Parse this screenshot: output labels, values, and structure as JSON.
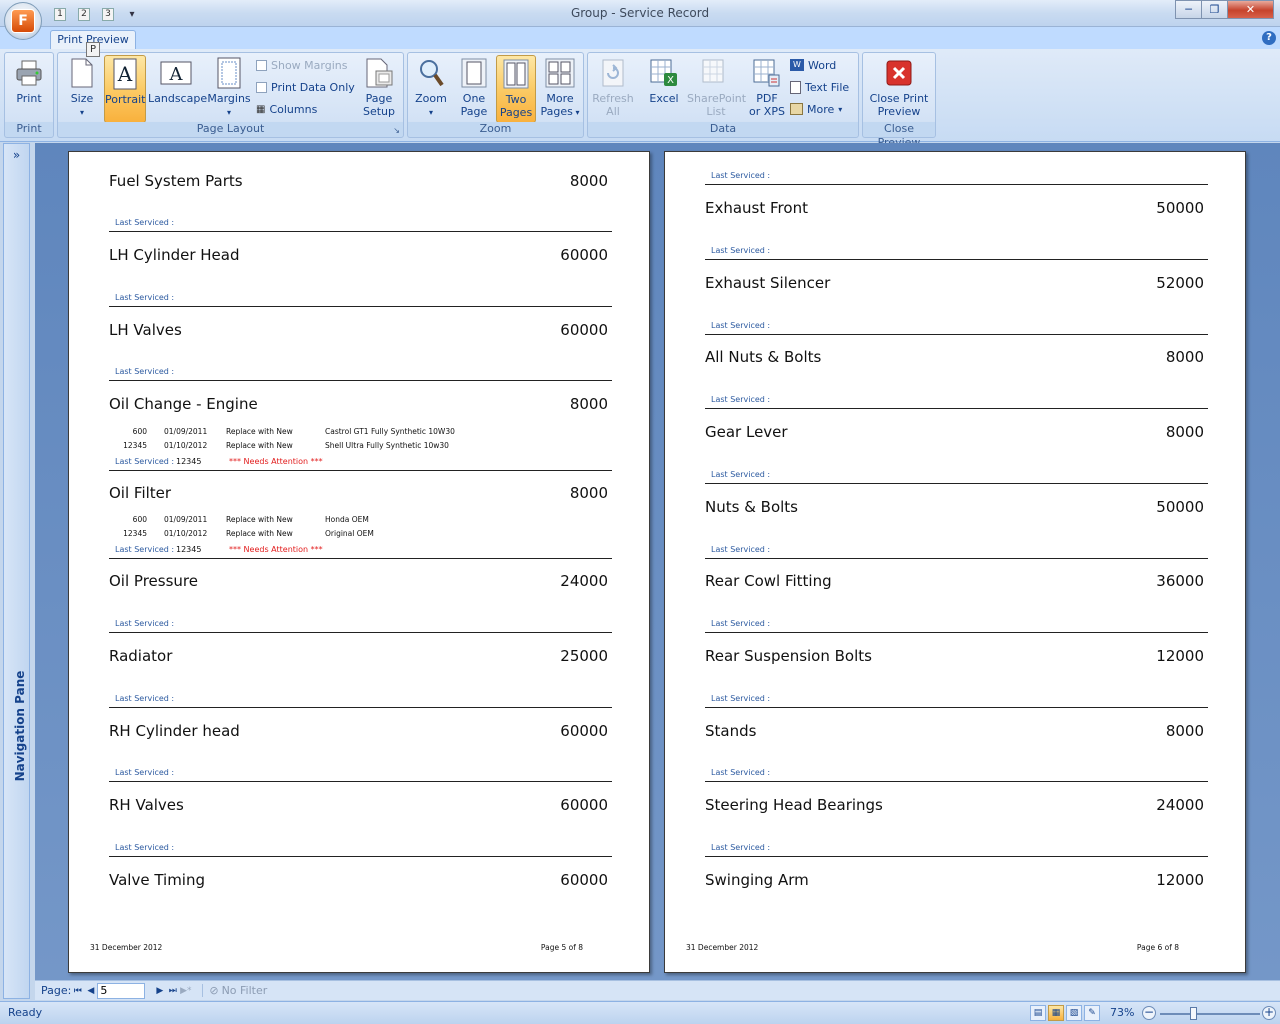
{
  "window": {
    "title": "Group  -  Service Record",
    "office_logo": "F",
    "qat_keys": [
      "1",
      "2",
      "3"
    ],
    "min": "─",
    "max": "❐",
    "close": "✕"
  },
  "ribbon": {
    "active_tab": "Print Preview",
    "keytip": "P",
    "help": "?",
    "groups": {
      "print": {
        "label": "Print",
        "print_btn": "Print"
      },
      "page_layout": {
        "label": "Page Layout",
        "size": "Size",
        "portrait": "Portrait",
        "landscape": "Landscape",
        "margins": "Margins",
        "show_margins": "Show Margins",
        "print_data_only": "Print Data Only",
        "columns": "Columns",
        "page_setup_line1": "Page",
        "page_setup_line2": "Setup"
      },
      "zoom": {
        "label": "Zoom",
        "zoom": "Zoom",
        "one_page_line1": "One",
        "one_page_line2": "Page",
        "two_pages_line1": "Two",
        "two_pages_line2": "Pages",
        "more_pages_line1": "More",
        "more_pages_line2": "Pages"
      },
      "data": {
        "label": "Data",
        "refresh_line1": "Refresh",
        "refresh_line2": "All",
        "excel": "Excel",
        "sharepoint_line1": "SharePoint",
        "sharepoint_line2": "List",
        "pdf_line1": "PDF",
        "pdf_line2": "or XPS",
        "word": "Word",
        "text_file": "Text File",
        "more": "More"
      },
      "close_preview": {
        "label": "Close Preview",
        "close_line1": "Close Print",
        "close_line2": "Preview"
      }
    }
  },
  "nav_pane": {
    "label": "Navigation Pane",
    "toggle": "»"
  },
  "report": {
    "last_serviced_label": "Last Serviced :",
    "needs_attention": "*** Needs Attention ***",
    "left_page": {
      "records": [
        {
          "item": "Fuel System Parts",
          "miles": "8000"
        },
        {
          "item": "LH Cylinder Head",
          "miles": "60000"
        },
        {
          "item": "LH Valves",
          "miles": "60000"
        },
        {
          "item": "Oil Change - Engine",
          "miles": "8000"
        },
        {
          "item": "Oil Filter",
          "miles": "8000"
        },
        {
          "item": "Oil Pressure",
          "miles": "24000"
        },
        {
          "item": "Radiator",
          "miles": "25000"
        },
        {
          "item": "RH Cylinder head",
          "miles": "60000"
        },
        {
          "item": "RH Valves",
          "miles": "60000"
        },
        {
          "item": "Valve Timing",
          "miles": "60000"
        }
      ],
      "oil_change_services": [
        {
          "miles": "600",
          "date": "01/09/2011",
          "action": "Replace with New",
          "part": "Castrol GT1 Fully Synthetic 10W30"
        },
        {
          "miles": "12345",
          "date": "01/10/2012",
          "action": "Replace with New",
          "part": "Shell Ultra Fully Synthetic 10w30"
        }
      ],
      "oil_change_last": "12345",
      "oil_filter_services": [
        {
          "miles": "600",
          "date": "01/09/2011",
          "action": "Replace with New",
          "part": "Honda OEM"
        },
        {
          "miles": "12345",
          "date": "01/10/2012",
          "action": "Replace with New",
          "part": "Original OEM"
        }
      ],
      "oil_filter_last": "12345",
      "footer_date": "31 December 2012",
      "footer_page": "Page 5 of 8"
    },
    "right_page": {
      "records": [
        {
          "item": "Exhaust Front",
          "miles": "50000"
        },
        {
          "item": "Exhaust Silencer",
          "miles": "52000"
        },
        {
          "item": "All Nuts & Bolts",
          "miles": "8000"
        },
        {
          "item": "Gear Lever",
          "miles": "8000"
        },
        {
          "item": "Nuts & Bolts",
          "miles": "50000"
        },
        {
          "item": "Rear Cowl Fitting",
          "miles": "36000"
        },
        {
          "item": "Rear Suspension Bolts",
          "miles": "12000"
        },
        {
          "item": "Stands",
          "miles": "8000"
        },
        {
          "item": "Steering Head Bearings",
          "miles": "24000"
        },
        {
          "item": "Swinging Arm",
          "miles": "12000"
        }
      ],
      "footer_date": "31 December 2012",
      "footer_page": "Page 6 of 8"
    }
  },
  "record_nav": {
    "page_label": "Page:",
    "page_value": "5",
    "no_filter": "No Filter"
  },
  "status": {
    "ready": "Ready",
    "zoom_level": "73%"
  },
  "colors": {
    "accent": "#15428b",
    "last_serviced": "#2c5aa0",
    "attention": "#e21d1d"
  }
}
